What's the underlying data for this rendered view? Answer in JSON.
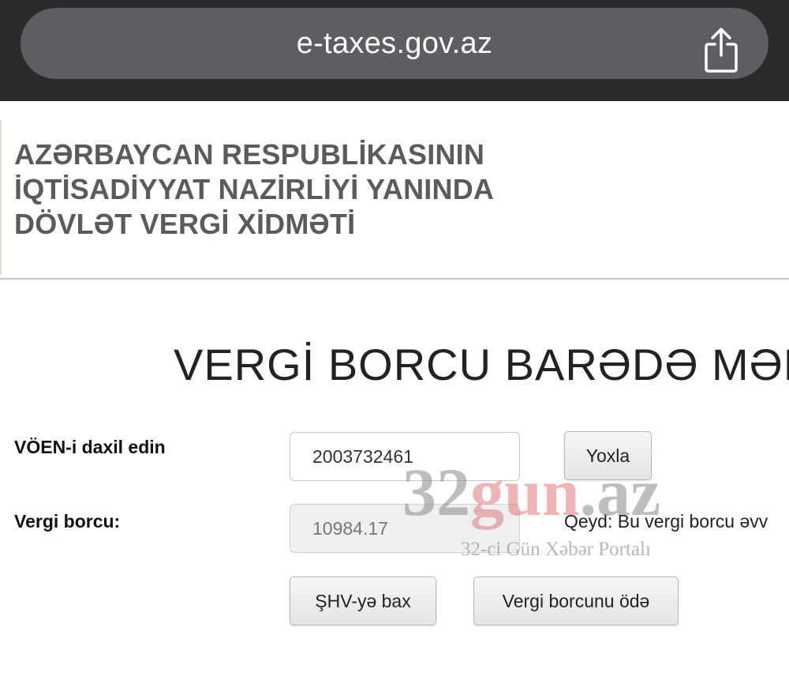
{
  "browser": {
    "url": "e-taxes.gov.az",
    "share_icon": "share-icon"
  },
  "header": {
    "org_line1": "AZƏRBAYCAN RESPUBLİKASININ",
    "org_line2": "İQTİSADİYYAT NAZİRLİYİ YANINDA",
    "org_line3": "DÖVLƏT VERGİ XİDMƏTİ"
  },
  "main": {
    "title": "VERGİ BORCU BARƏDƏ MƏL",
    "voen_label": "VÖEN-i daxil edin",
    "voen_value": "2003732461",
    "check_button": "Yoxla",
    "debt_label": "Vergi borcu:",
    "debt_value": "10984.17",
    "note": "Qeyd: Bu vergi borcu əvv",
    "shv_button": "ŞHV-yə bax",
    "pay_button": "Vergi borcunu ödə"
  },
  "watermark": {
    "brand_part1": "32",
    "brand_part2": "gun",
    "brand_part3": ".az",
    "tagline": "32-ci Gün Xəbər Portalı"
  },
  "colors": {
    "chrome_bg": "#2b2b2e",
    "urlbar_bg": "#5d5e62",
    "org_text": "#5b5b5b",
    "watermark_red": "#e07a7a"
  }
}
